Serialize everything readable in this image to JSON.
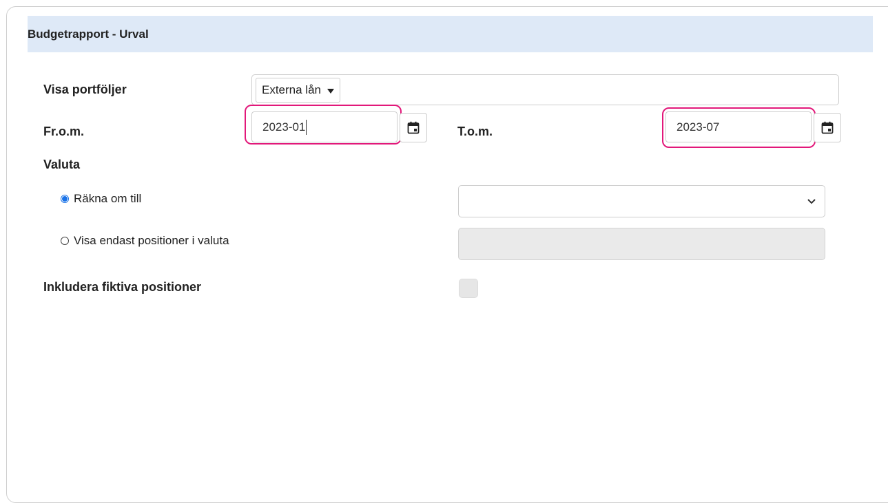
{
  "panel": {
    "title": "Budgetrapport - Urval"
  },
  "form": {
    "portfolios_label": "Visa portföljer",
    "portfolio_tag": "Externa lån",
    "from_label": "Fr.o.m.",
    "from_value": "2023-01",
    "to_label": "T.o.m.",
    "to_value": "2023-07",
    "currency_label": "Valuta",
    "convert_radio_label": "Räkna om till",
    "convert_radio_checked": true,
    "only_currency_radio_label": "Visa endast positioner i valuta",
    "only_currency_radio_checked": false,
    "convert_select_value": "",
    "only_currency_select_value": "",
    "include_fictive_label": "Inkludera fiktiva positioner",
    "include_fictive_checked": false
  },
  "colors": {
    "header_bg": "#dee9f7",
    "highlight": "#e2187a",
    "radio_accent": "#1a73e8",
    "disabled_bg": "#eaeaea"
  },
  "icons": {
    "calendar": "calendar-icon",
    "dropdown": "caret-down-icon",
    "chevron": "chevron-down-icon"
  }
}
